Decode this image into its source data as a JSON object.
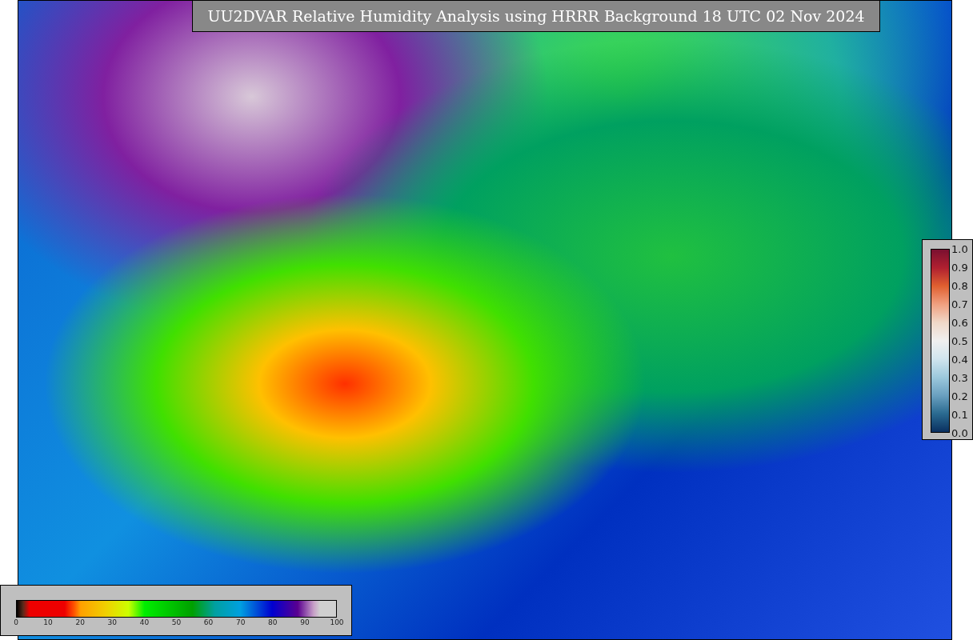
{
  "title": "UU2DVAR Relative Humidity Analysis using HRRR Background 18 UTC 02 Nov 2024",
  "humidity_colorbar": {
    "ticks": [
      "0",
      "10",
      "20",
      "30",
      "40",
      "50",
      "60",
      "70",
      "80",
      "90",
      "100"
    ]
  },
  "observation_colorbar": {
    "ticks": [
      "1.0",
      "0.9",
      "0.8",
      "0.7",
      "0.6",
      "0.5",
      "0.4",
      "0.3",
      "0.2",
      "0.1",
      "0.0"
    ]
  }
}
